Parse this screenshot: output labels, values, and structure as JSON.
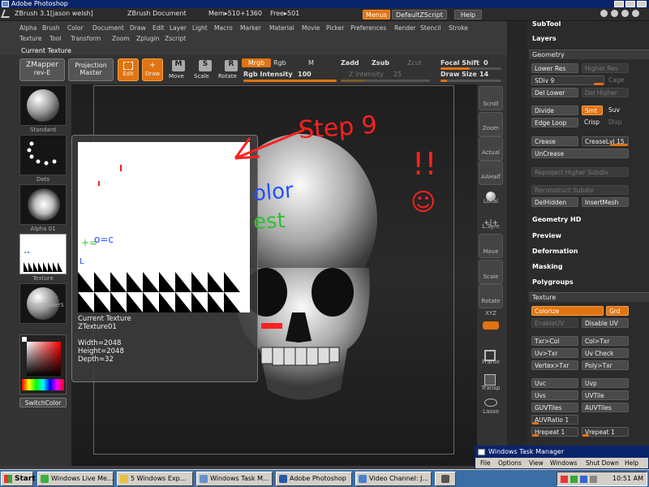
{
  "photoshop": {
    "title": "Adobe Photoshop"
  },
  "zbrush_titlebar": {
    "app": "ZBrush 3.1[jason welsh]",
    "document": "ZBrush Document",
    "mem": "Mem▸510+1360",
    "free": "Free▸501",
    "menus_btn": "Menus",
    "script_btn": "DefaultZScript",
    "help_btn": "Help"
  },
  "menu": {
    "row1": [
      "Alpha",
      "Brush",
      "Color",
      "Document",
      "Draw",
      "Edit",
      "Layer",
      "Light",
      "Macro",
      "Marker",
      "Material",
      "Movie",
      "Picker",
      "Preferences",
      "Render",
      "Stencil",
      "Stroke"
    ],
    "row2": [
      "Texture",
      "Tool",
      "Transform",
      "Zoom",
      "Zplugin",
      "Zscript"
    ]
  },
  "shelf": {
    "current_texture_label": "Current Texture",
    "zmapper": "ZMapper",
    "zmapper_rev": "rev-E",
    "projection": "Projection",
    "projection_master": "Master",
    "edit": "Edit",
    "draw": "Draw",
    "move": "Move",
    "scale": "Scale",
    "rotate": "Rotate",
    "mrgb": "Mrgb",
    "rgb": "Rgb",
    "m": "M",
    "zadd": "Zadd",
    "zsub": "Zsub",
    "zcut": "Zcut",
    "rgb_intensity_label": "Rgb Intensity",
    "rgb_intensity": "100",
    "z_intensity_label": "Z Intensity",
    "z_intensity": "25",
    "focal_shift_label": "Focal Shift",
    "focal_shift": "0",
    "draw_size_label": "Draw Size",
    "draw_size": "14"
  },
  "left_shelf": {
    "standard": "Standard",
    "dots": "Dots",
    "alpha": "Alpha 01",
    "texture": "Texture",
    "fastshader": "FastShaderS",
    "switchcolor": "SwitchColor"
  },
  "texture_popup": {
    "title": "Current Texture",
    "name": "ZTexture01",
    "width": "Width=2048",
    "height": "Height=2048",
    "depth": "Depth=32"
  },
  "annotation": {
    "step": "Step 9",
    "exclaim": "!!",
    "smile": "☺",
    "canvas_text1": "olor",
    "canvas_text2": "est"
  },
  "right_shelf": {
    "items": [
      "Scroll",
      "Zoom",
      "Actual",
      "AAHalf",
      "Local",
      "L.Sym",
      "Move",
      "Scale",
      "Rotate",
      "XYZ",
      "Frame",
      "Transp",
      "Lasso"
    ]
  },
  "panel": {
    "subtool": "SubTool",
    "layers": "Layers",
    "geometry": "Geometry",
    "lower_res": "Lower Res",
    "higher_res": "Higher Res",
    "sdiv": "SDiv 9",
    "cage": "Cage",
    "del_lower": "Del Lower",
    "del_higher": "Del Higher",
    "divide": "Divide",
    "smt": "Smt",
    "suv": "Suv",
    "edge_loop": "Edge Loop",
    "crisp": "Crisp",
    "disp": "Disp",
    "crease": "Crease",
    "creaselvl": "CreaseLvl 15",
    "uncrease": "UnCrease",
    "reproject": "Reproject Higher Subdiv",
    "reconstruct": "Reconstruct Subdiv",
    "delhidden": "DelHidden",
    "insertmesh": "InsertMesh",
    "geometry_hd": "Geometry HD",
    "preview": "Preview",
    "deformation": "Deformation",
    "masking": "Masking",
    "polygroups": "Polygroups",
    "texture": "Texture",
    "colorize": "Colorize",
    "grd": "Grd",
    "enable_uv": "EnableUV",
    "disable_uv": "Disable UV",
    "txr_col": "Txr>Col",
    "col_txr": "Col>Txr",
    "uv_txr": "Uv>Txr",
    "uv_check": "Uv Check",
    "vertex_txr": "Vertex>Txr",
    "poly_txr": "Poly>Txr",
    "uvc": "Uvc",
    "uvp": "Uvp",
    "uvs": "Uvs",
    "uvtile": "UVTile",
    "guvtiles": "GUVTiles",
    "auvtiles": "AUVTiles",
    "auvratio": "AUVRatio 1",
    "hrepeat": "Hrepeat 1",
    "vrepeat": "Vrepeat 1"
  },
  "task_manager": {
    "title": "Windows Task Manager",
    "menu": [
      "File",
      "Options",
      "View",
      "Windows",
      "Shut Down",
      "Help"
    ]
  },
  "taskbar": {
    "start": "Start",
    "tasks": [
      "Windows Live Me...",
      "5 Windows Exp...",
      "Windows Task M...",
      "Adobe Photoshop",
      "Video Channel: J..."
    ],
    "time": "10:51 AM"
  },
  "colors": {
    "accent": "#e07410",
    "annotation_red": "#ff2020",
    "annotation_blue": "#2050ff",
    "annotation_green": "#30c030"
  }
}
